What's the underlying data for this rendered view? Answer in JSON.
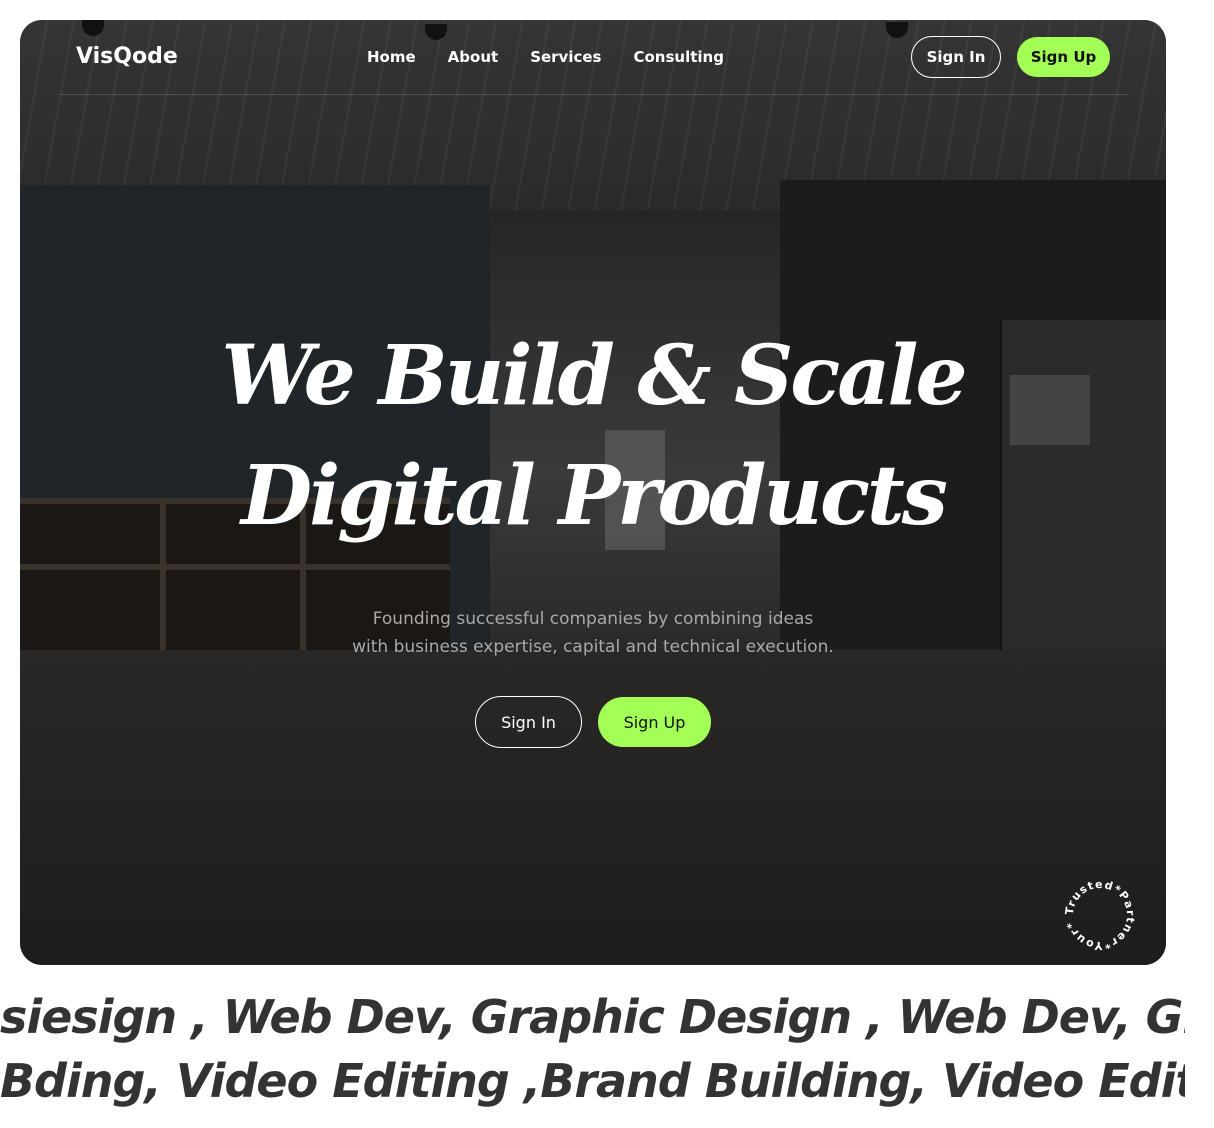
{
  "nav": {
    "logo": "VisQode",
    "items": [
      {
        "label": "Home"
      },
      {
        "label": "About"
      },
      {
        "label": "Services"
      },
      {
        "label": "Consulting"
      }
    ],
    "signin_label": "Sign In",
    "signup_label": "Sign Up"
  },
  "hero": {
    "headline_line1": "We Build & Scale",
    "headline_line2": "Digital Products",
    "subtitle_line1": "Founding successful companies by combining ideas",
    "subtitle_line2": "with business expertise, capital and technical execution.",
    "signin_label": "Sign In",
    "signup_label": "Sign Up",
    "badge_text": "Trusted*Partner*Your*"
  },
  "marquee": {
    "line1": "siesign , Web Dev, Graphic Design , Web Dev, Graphic",
    "line2": " Bding, Video Editing ,Brand Building, Video Editing ,B"
  },
  "colors": {
    "accent": "#a3ff55",
    "hero_bg": "#1f1d1b",
    "marquee_text": "#333333"
  }
}
